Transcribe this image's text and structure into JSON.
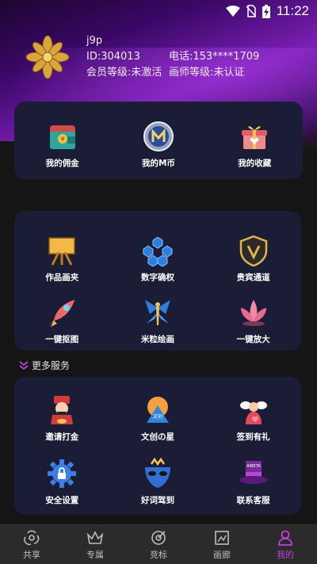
{
  "status": {
    "time": "11:22"
  },
  "profile": {
    "name": "j9p",
    "id": "ID:304013",
    "phone": "电话:153****1709",
    "member_level": "会员等级:未激活",
    "painter_level": "画师等级:未认证"
  },
  "top_menu": [
    {
      "label": "我的佣金",
      "icon": "wallet-icon"
    },
    {
      "label": "我的M币",
      "icon": "m-coin-icon"
    },
    {
      "label": "我的收藏",
      "icon": "gift-box-icon"
    }
  ],
  "features": [
    {
      "label": "作品画夹",
      "icon": "easel-icon"
    },
    {
      "label": "数字确权",
      "icon": "blockchain-cubes-icon"
    },
    {
      "label": "贵宾通道",
      "icon": "vip-shield-icon"
    },
    {
      "label": "一键抠图",
      "icon": "rocket-icon"
    },
    {
      "label": "米粒绘画",
      "icon": "fairy-icon"
    },
    {
      "label": "一键放大",
      "icon": "lotus-icon"
    }
  ],
  "more_services": {
    "title": "更多服务",
    "items": [
      {
        "label": "邀请打金",
        "icon": "god-of-wealth-icon"
      },
      {
        "label": "文创の星",
        "icon": "planet-icon"
      },
      {
        "label": "签到有礼",
        "icon": "cupid-icon"
      },
      {
        "label": "安全设置",
        "icon": "gear-lock-icon"
      },
      {
        "label": "好词驾到",
        "icon": "mask-icon"
      },
      {
        "label": "联系客服",
        "icon": "hat-icon",
        "hat_text": "AIBETA"
      }
    ]
  },
  "tabs": [
    {
      "label": "共享",
      "icon": "share-icon",
      "active": false
    },
    {
      "label": "专属",
      "icon": "crown-icon",
      "active": false
    },
    {
      "label": "竞标",
      "icon": "target-icon",
      "active": false
    },
    {
      "label": "画廊",
      "icon": "gallery-icon",
      "active": false
    },
    {
      "label": "我的",
      "icon": "person-icon",
      "active": true
    }
  ],
  "colors": {
    "accent": "#c03fe0",
    "card": "#1b1c36",
    "background": "#151515"
  }
}
